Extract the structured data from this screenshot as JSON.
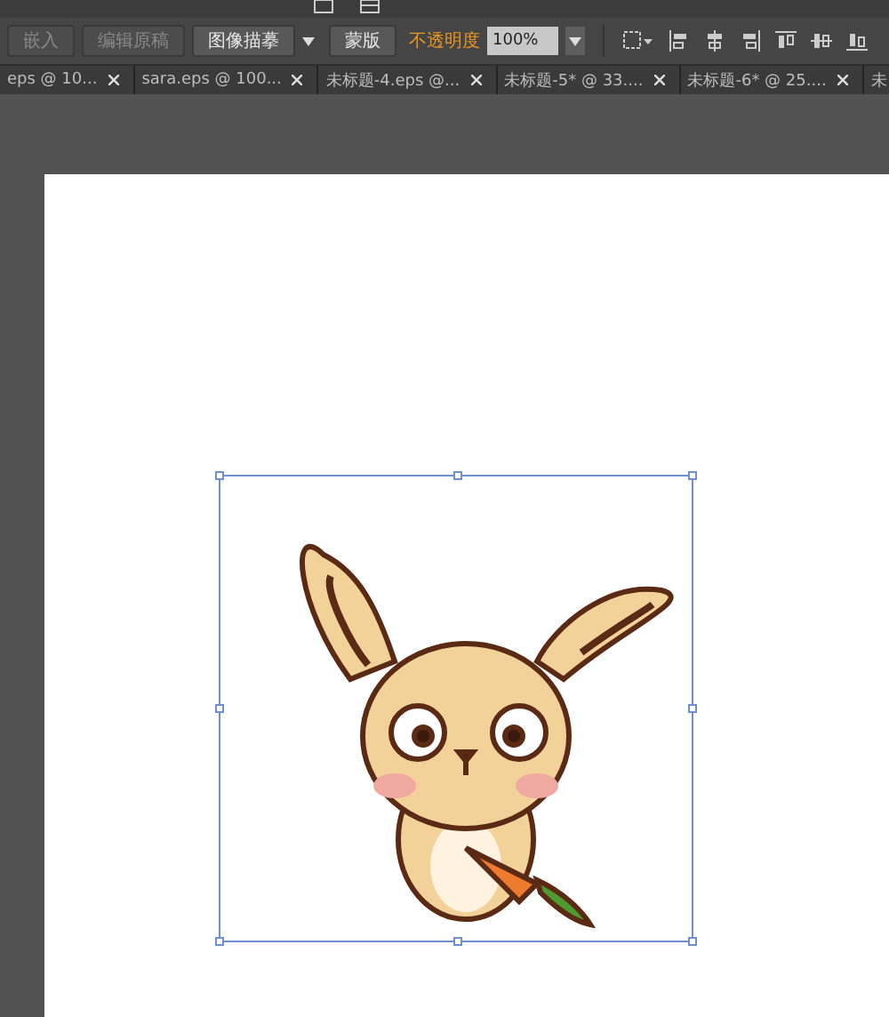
{
  "toolbar": {
    "buttons": [
      {
        "label": "嵌入",
        "disabled": true
      },
      {
        "label": "编辑原稿",
        "disabled": true
      },
      {
        "label": "图像描摹",
        "disabled": false,
        "dropdown": true
      },
      {
        "label": "蒙版",
        "disabled": false,
        "dropdown": false
      }
    ],
    "opacity": {
      "label": "不透明度",
      "value": "100%"
    }
  },
  "tabs": [
    {
      "label": "eps @ 10...",
      "selected": false
    },
    {
      "label": "sara.eps @ 100...",
      "selected": false
    },
    {
      "label": "未标题-4.eps @...",
      "selected": false
    },
    {
      "label": "未标题-5* @ 33....",
      "selected": false
    },
    {
      "label": "未标题-6* @ 25....",
      "selected": false
    },
    {
      "label": "未",
      "selected": false
    }
  ]
}
